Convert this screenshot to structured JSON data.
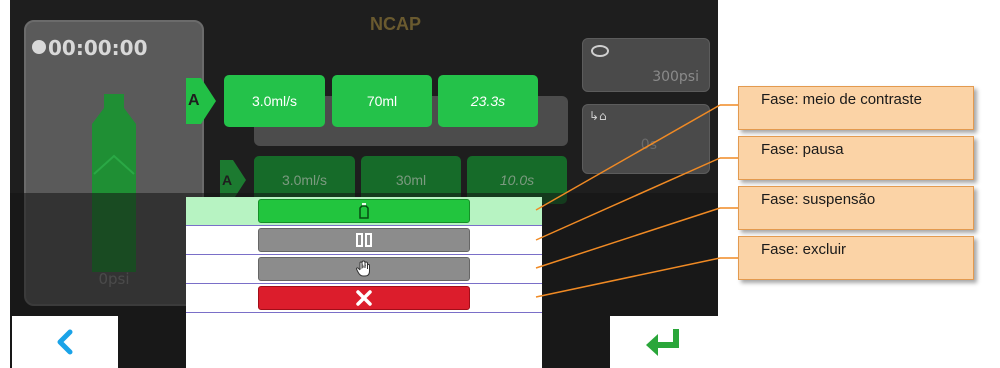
{
  "screen": {
    "title": "NCAP",
    "timer": "00:00:00",
    "syringe_pressure": "0psi",
    "pressure_limit": "300psi",
    "delay_time": "0s"
  },
  "phase1": {
    "label": "A",
    "flow": "3.0ml/s",
    "volume": "70ml",
    "duration": "23.3s"
  },
  "phase2": {
    "label": "A",
    "flow": "3.0ml/s",
    "volume": "30ml",
    "duration": "10.0s"
  },
  "menu": {
    "items": [
      {
        "icon": "bottle-icon",
        "color": "#22c53e"
      },
      {
        "icon": "pause-icon",
        "color": "#8c8c8c"
      },
      {
        "icon": "hand-icon",
        "color": "#8c8c8c"
      },
      {
        "icon": "close-icon",
        "color": "#dc1d2c"
      }
    ]
  },
  "nav": {
    "back_icon": "chevron-left-icon",
    "enter_icon": "enter-arrow-icon"
  },
  "callouts": [
    "Fase: meio de contraste",
    "Fase: pausa",
    "Fase: suspensão",
    "Fase: excluir"
  ]
}
